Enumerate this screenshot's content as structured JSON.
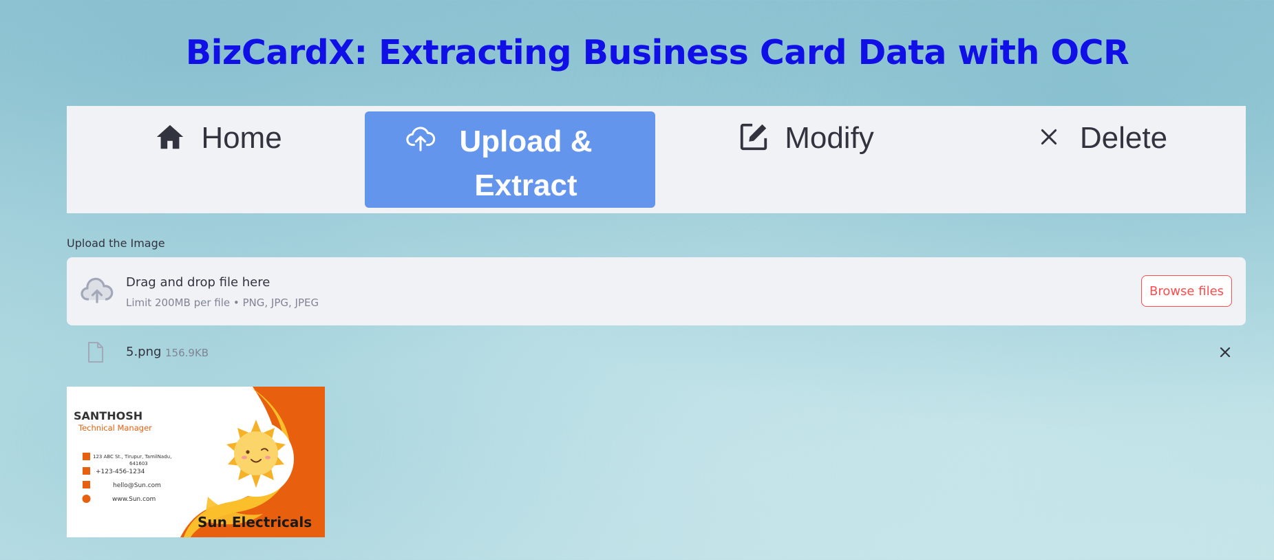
{
  "app": {
    "title": "BizCardX: Extracting Business Card Data with OCR"
  },
  "nav": {
    "items": [
      {
        "label": "Home",
        "icon": "home-icon"
      },
      {
        "label": "Upload & Extract",
        "icon": "cloud-upload-icon",
        "active": true
      },
      {
        "label": "Modify",
        "icon": "edit-icon"
      },
      {
        "label": "Delete",
        "icon": "x-icon"
      }
    ],
    "active_color": "#6495ED"
  },
  "uploader": {
    "label": "Upload the Image",
    "drop_text": "Drag and drop file here",
    "limit_text": "Limit 200MB per file • PNG, JPG, JPEG",
    "browse_label": "Browse files",
    "accent_color": "#FF4B4B"
  },
  "uploaded_file": {
    "name": "5.png",
    "size": "156.9KB"
  },
  "card": {
    "name": "SANTHOSH",
    "designation": "Technical Manager",
    "address_line1": "123 ABC St., Tirupur, TamilNadu,",
    "address_line2": "641603",
    "phone": "+123-456-1234",
    "email": "hello@Sun.com",
    "website": "www.Sun.com",
    "company": "Sun Electricals"
  }
}
